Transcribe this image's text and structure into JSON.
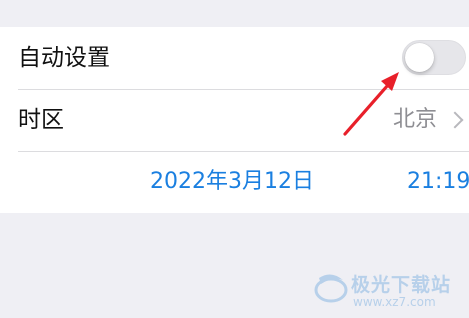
{
  "settings": {
    "auto_set": {
      "label": "自动设置",
      "enabled": false
    },
    "time_zone": {
      "label": "时区",
      "value": "北京"
    },
    "date_time": {
      "date": "2022年3月12日",
      "time": "21:19"
    }
  },
  "annotation": {
    "arrow_color": "#e8202a"
  },
  "watermark": {
    "name": "极光下载站",
    "url": "www.xz7.com"
  },
  "colors": {
    "accent_blue": "#1a7fe0",
    "secondary_text": "#8e8e93"
  }
}
